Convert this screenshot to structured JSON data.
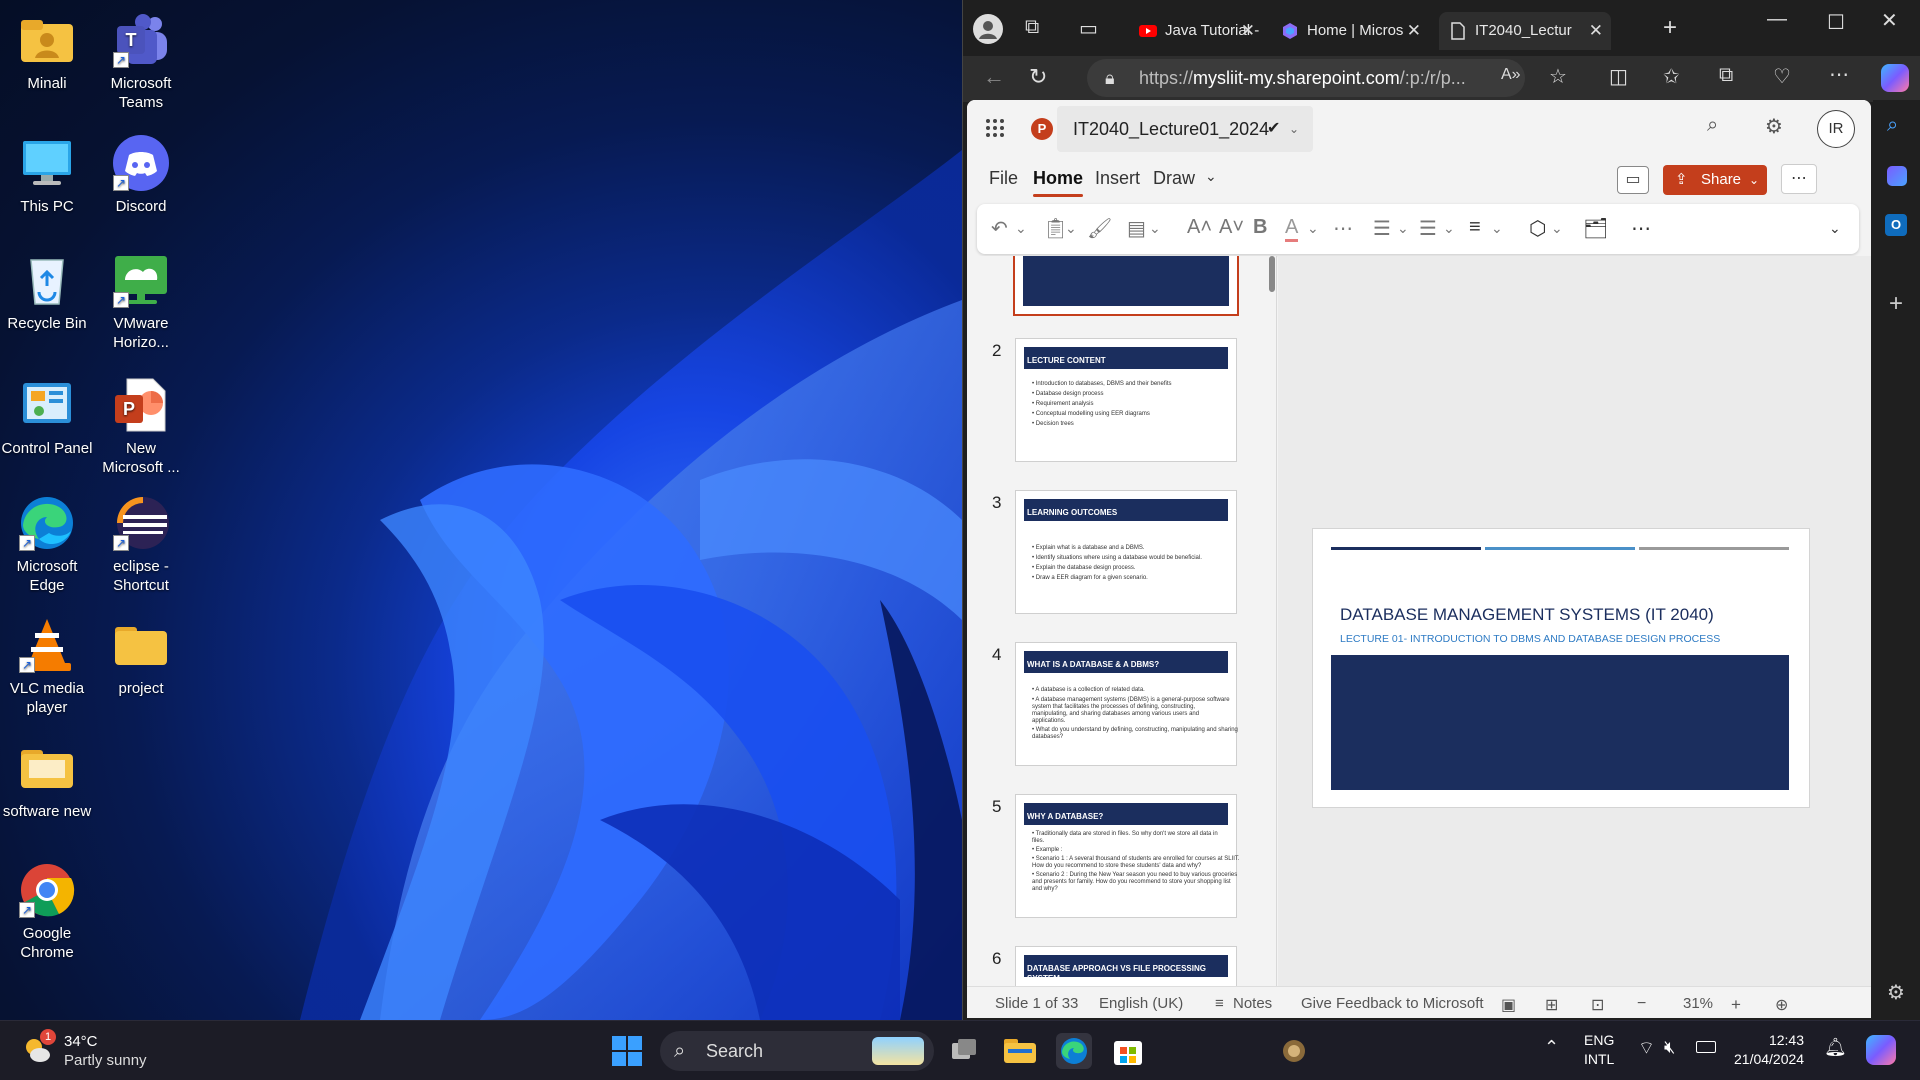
{
  "desktop": {
    "icons": [
      {
        "label": "Minali",
        "icon": "user-folder-icon"
      },
      {
        "label": "Microsoft Teams",
        "icon": "teams-icon"
      },
      {
        "label": "This PC",
        "icon": "monitor-icon"
      },
      {
        "label": "Discord",
        "icon": "discord-icon"
      },
      {
        "label": "Recycle Bin",
        "icon": "recycle-bin-icon"
      },
      {
        "label": "VMware Horizo...",
        "icon": "vmware-horizon-icon"
      },
      {
        "label": "Control Panel",
        "icon": "control-panel-icon"
      },
      {
        "label": "New Microsoft ...",
        "icon": "powerpoint-file-icon"
      },
      {
        "label": "Microsoft Edge",
        "icon": "edge-icon"
      },
      {
        "label": "eclipse - Shortcut",
        "icon": "eclipse-icon"
      },
      {
        "label": "VLC media player",
        "icon": "vlc-icon"
      },
      {
        "label": "project",
        "icon": "folder-icon"
      },
      {
        "label": "software new",
        "icon": "folder-icon"
      },
      {
        "label": "Google Chrome",
        "icon": "chrome-icon"
      }
    ]
  },
  "browser": {
    "tabs": [
      {
        "label": "Java Tutorial -",
        "icon": "youtube-icon"
      },
      {
        "label": "Home | Micros",
        "icon": "copilot-icon"
      },
      {
        "label": "IT2040_Lectur",
        "icon": "document-icon"
      }
    ],
    "url_prefix": "https://",
    "url_domain": "mysliit-my.sharepoint.com",
    "url_rest": "/:p:/r/p..."
  },
  "office": {
    "doc_title": "IT2040_Lecture01_2024",
    "avatar": "IR",
    "menu_tabs": [
      "File",
      "Home",
      "Insert",
      "Draw"
    ],
    "share_label": "Share",
    "slides": [
      {
        "num": "2",
        "header": "LECTURE CONTENT",
        "bullets": [
          "• Introduction to databases, DBMS and their benefits",
          "• Database design process",
          "• Requirement analysis",
          "• Conceptual modelling using EER diagrams",
          "• Decision trees"
        ]
      },
      {
        "num": "3",
        "header": "LEARNING OUTCOMES",
        "bullets": [
          "• Explain what is a database and a DBMS.",
          "• Identify situations where using a database would be beneficial.",
          "• Explain the database design process.",
          "• Draw a EER diagram for a given scenario."
        ]
      },
      {
        "num": "4",
        "header": "WHAT IS A DATABASE & A DBMS?",
        "bullets": [
          "• A database is a collection of related data.",
          "• A database management systems (DBMS) is a general-purpose software",
          "  system that facilitates the processes of defining, constructing,",
          "  manipulating, and sharing databases among various users and",
          "  applications.",
          "  • What do you understand by defining, constructing, manipulating and sharing",
          "    databases?"
        ]
      },
      {
        "num": "5",
        "header": "WHY A DATABASE?",
        "bullets": [
          "• Traditionally data are stored in files. So why don't we store all data in",
          "  files.",
          "• Example :",
          "  • Scenario 1 : A several thousand of students are enrolled for courses at SLIIT.",
          "    How do you recommend to store these students' data and why?",
          "  • Scenario 2 : During the New Year season you need to buy various groceries",
          "    and presents for family. How do you recommend to store your shopping list",
          "    and why?"
        ]
      },
      {
        "num": "6",
        "header": "DATABASE APPROACH VS FILE PROCESSING SYSTEM",
        "bullets": []
      }
    ],
    "main_slide": {
      "title": "DATABASE MANAGEMENT SYSTEMS (IT 2040)",
      "subtitle": "LECTURE 01- INTRODUCTION TO DBMS AND DATABASE DESIGN PROCESS"
    },
    "status": {
      "slide_count": "Slide 1 of 33",
      "language": "English (UK)",
      "notes": "Notes",
      "feedback": "Give Feedback to Microsoft",
      "zoom": "31%"
    }
  },
  "taskbar": {
    "temperature": "34°C",
    "weather": "Partly sunny",
    "weather_badge": "1",
    "search_label": "Search",
    "lang_top": "ENG",
    "lang_bottom": "INTL",
    "time": "12:43",
    "date": "21/04/2024"
  },
  "colors": {
    "accent_powerpoint": "#c43e1c",
    "slide_navy": "#1b2e5e",
    "slide_link_blue": "#2e7bc4"
  }
}
